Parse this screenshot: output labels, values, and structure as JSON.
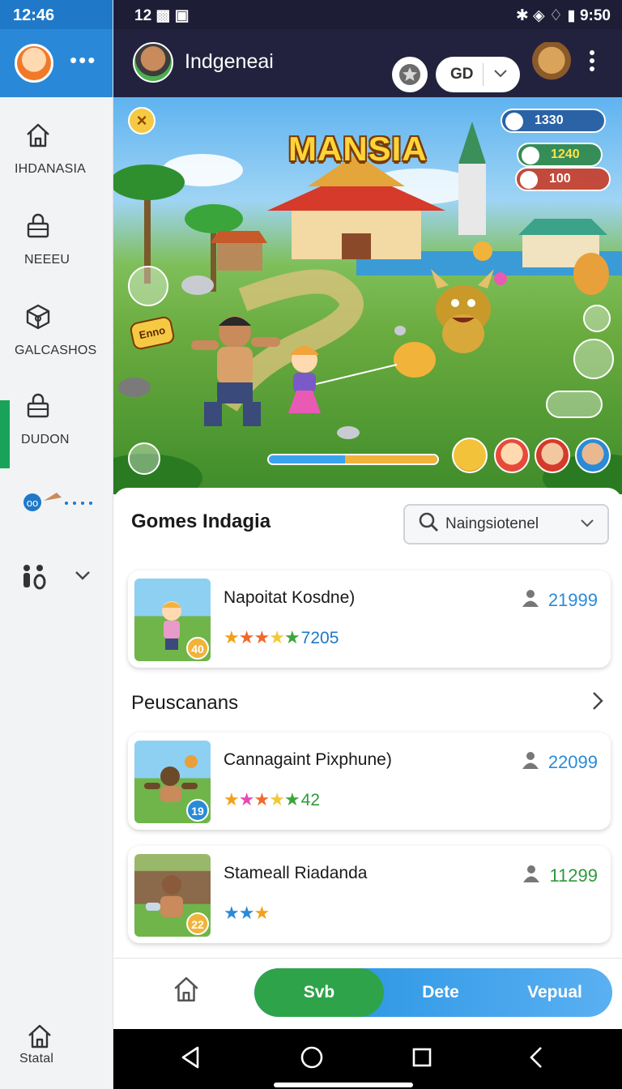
{
  "sidebar": {
    "status_time": "12:46",
    "items": [
      {
        "label": "IHDANASIA"
      },
      {
        "label": "NEEEU"
      },
      {
        "label": "GALCASHOS"
      },
      {
        "label": "DUDON"
      }
    ],
    "bottom_label": "Statal"
  },
  "statusbar": {
    "left": "12",
    "right": "9:50"
  },
  "topbar": {
    "title": "Indgeneai",
    "select_value": "GD"
  },
  "banner": {
    "title": "MANSIA",
    "stat_1": "1330",
    "stat_2": "1240",
    "stat_3": "100",
    "tag": "Enno",
    "progress_blue": 0.45,
    "progress_orange": 0.55
  },
  "section1": {
    "title": "Gomes Indagia",
    "dropdown_value": "Naingsiotenel"
  },
  "section2": {
    "title": "Peuscanans"
  },
  "games": [
    {
      "name": "Napoitat Kosdne)",
      "rating": "7205",
      "count": "21999",
      "badge": "40",
      "stars": 5
    },
    {
      "name": "Cannagaint Pixphune)",
      "rating": "42",
      "count": "22099",
      "badge": "19",
      "stars": 5
    },
    {
      "name": "Stameall Riadanda",
      "rating": "",
      "count": "11299",
      "badge": "22",
      "stars": 3
    }
  ],
  "tabs": {
    "seg_1": "Svb",
    "seg_2": "Dete",
    "seg_3": "Vepual"
  },
  "colors": {
    "accent_blue": "#2a88d8",
    "dark_header": "#22223e",
    "green": "#2fa34a",
    "active_indicator": "#19a35a"
  },
  "icons": [
    "home-icon",
    "lock-icon",
    "box-icon",
    "lock-icon",
    "people-icon",
    "search-icon",
    "chevron-down-icon",
    "chevron-right-icon",
    "user-icon",
    "star-icon",
    "more-icon",
    "back-icon",
    "recents-icon"
  ]
}
